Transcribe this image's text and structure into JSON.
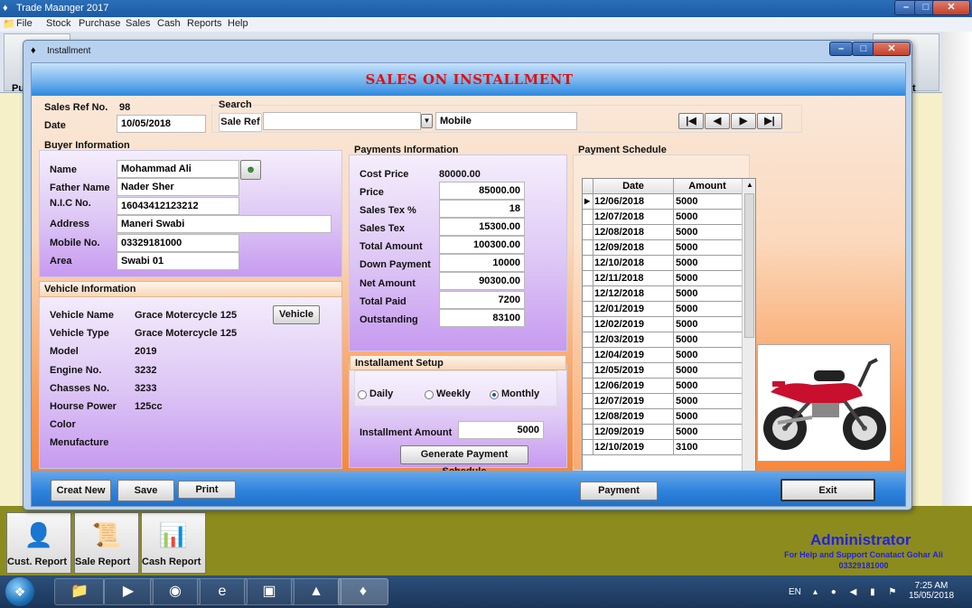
{
  "app": {
    "title": "Trade Maanger 2017",
    "menu": [
      "File",
      "Stock",
      "Purchase",
      "Sales",
      "Cash",
      "Reports",
      "Help"
    ],
    "toolbar_partial_labels": {
      "left": "Pu",
      "right": "it"
    }
  },
  "window": {
    "title": "Installment",
    "header": "SALES ON INSTALLMENT"
  },
  "top": {
    "sales_ref_label": "Sales Ref No.",
    "sales_ref_value": "98",
    "date_label": "Date",
    "date_value": "10/05/2018",
    "search_label": "Search",
    "sale_ref_label": "Sale Ref",
    "sale_ref_value": "",
    "mobile_value": "Mobile"
  },
  "nav": [
    "|◀",
    "◀",
    "▶",
    "▶|"
  ],
  "buyer": {
    "title": "Buyer Information",
    "fields": [
      {
        "label": "Name",
        "value": "Mohammad Ali"
      },
      {
        "label": "Father Name",
        "value": "Nader Sher"
      },
      {
        "label": "N.I.C No.",
        "value": "16043412123212"
      },
      {
        "label": "Address",
        "value": "Maneri Swabi"
      },
      {
        "label": "Mobile No.",
        "value": "03329181000"
      },
      {
        "label": "Area",
        "value": "Swabi 01"
      }
    ]
  },
  "vehicle": {
    "title": "Vehicle Information",
    "button": "Vehicle",
    "fields": [
      {
        "label": "Vehicle Name",
        "value": "Grace Motercycle 125"
      },
      {
        "label": "Vehicle Type",
        "value": "Grace Motercycle 125"
      },
      {
        "label": "Model",
        "value": "2019"
      },
      {
        "label": "Engine No.",
        "value": "3232"
      },
      {
        "label": "Chasses No.",
        "value": "3233"
      },
      {
        "label": "Hourse Power",
        "value": "125cc"
      },
      {
        "label": "Color",
        "value": ""
      },
      {
        "label": "Menufacture",
        "value": ""
      }
    ]
  },
  "payments": {
    "title": "Payments Information",
    "cost_price_label": "Cost Price",
    "cost_price_value": "80000.00",
    "fields": [
      {
        "label": "Price",
        "value": "85000.00"
      },
      {
        "label": "Sales Tex %",
        "value": "18"
      },
      {
        "label": "Sales Tex",
        "value": "15300.00"
      },
      {
        "label": "Total Amount",
        "value": "100300.00"
      },
      {
        "label": "Down Payment",
        "value": "10000"
      },
      {
        "label": "Net Amount",
        "value": "90300.00"
      },
      {
        "label": "Total Paid",
        "value": "7200"
      },
      {
        "label": "Outstanding",
        "value": "83100"
      }
    ]
  },
  "installment": {
    "title": "Installament Setup",
    "options": [
      "Daily",
      "Weekly",
      "Monthly"
    ],
    "selected": "Monthly",
    "amount_label": "Installment Amount",
    "amount_value": "5000",
    "generate_button": "Generate Payment Schedule"
  },
  "schedule": {
    "title": "Payment Schedule",
    "columns": [
      "Date",
      "Amount"
    ],
    "rows": [
      {
        "date": "12/06/2018",
        "amount": "5000"
      },
      {
        "date": "12/07/2018",
        "amount": "5000"
      },
      {
        "date": "12/08/2018",
        "amount": "5000"
      },
      {
        "date": "12/09/2018",
        "amount": "5000"
      },
      {
        "date": "12/10/2018",
        "amount": "5000"
      },
      {
        "date": "12/11/2018",
        "amount": "5000"
      },
      {
        "date": "12/12/2018",
        "amount": "5000"
      },
      {
        "date": "12/01/2019",
        "amount": "5000"
      },
      {
        "date": "12/02/2019",
        "amount": "5000"
      },
      {
        "date": "12/03/2019",
        "amount": "5000"
      },
      {
        "date": "12/04/2019",
        "amount": "5000"
      },
      {
        "date": "12/05/2019",
        "amount": "5000"
      },
      {
        "date": "12/06/2019",
        "amount": "5000"
      },
      {
        "date": "12/07/2019",
        "amount": "5000"
      },
      {
        "date": "12/08/2019",
        "amount": "5000"
      },
      {
        "date": "12/09/2019",
        "amount": "5000"
      },
      {
        "date": "12/10/2019",
        "amount": "3100"
      }
    ]
  },
  "footer": {
    "creat_new": "Creat New",
    "save": "Save",
    "print": "Print",
    "payment": "Payment",
    "exit": "Exit"
  },
  "reports": [
    "Cust. Report",
    "Sale Report",
    "Cash Report"
  ],
  "status": {
    "user": "Administrator",
    "support": "For Help and Support Conatact Gohar Ali",
    "phone": "03329181000"
  },
  "taskbar": {
    "lang": "EN",
    "time": "7:25 AM",
    "date": "15/05/2018"
  },
  "colors": {
    "header_title": "#e01010",
    "footer_band": "#2d83dc",
    "admin_text": "#2222dd"
  }
}
